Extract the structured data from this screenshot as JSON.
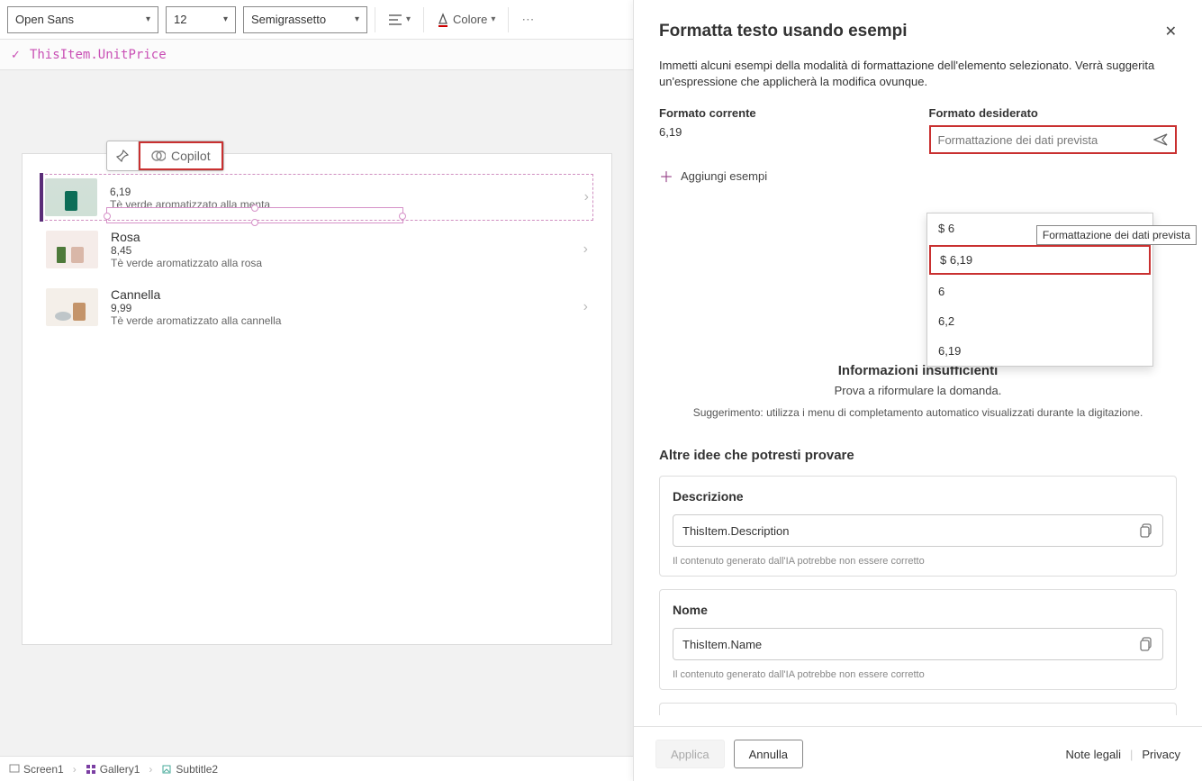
{
  "toolbar": {
    "font": "Open Sans",
    "size": "12",
    "weight": "Semigrassetto",
    "color_label": "Colore"
  },
  "formula": "ThisItem.UnitPrice",
  "gallery": {
    "copilot_label": "Copilot",
    "items": [
      {
        "title": "",
        "price": "6,19",
        "desc": "Tè verde aromatizzato alla menta"
      },
      {
        "title": "Rosa",
        "price": "8,45",
        "desc": "Tè verde aromatizzato alla rosa"
      },
      {
        "title": "Cannella",
        "price": "9,99",
        "desc": "Tè verde aromatizzato alla cannella"
      }
    ]
  },
  "breadcrumb": {
    "a": "Screen1",
    "b": "Gallery1",
    "c": "Subtitle2"
  },
  "panel": {
    "title": "Formatta testo usando esempi",
    "intro": "Immetti alcuni esempi della modalità di formattazione dell'elemento selezionato. Verrà suggerita un'espressione che applicherà la modifica ovunque.",
    "current_label": "Formato corrente",
    "current_value": "6,19",
    "desired_label": "Formato desiderato",
    "desired_placeholder": "Formattazione dei dati prevista",
    "add_examples": "Aggiungi esempi",
    "tooltip": "Formattazione dei dati prevista",
    "suggestions": [
      "$ 6",
      "$ 6,19",
      "6",
      "6,2",
      "6,19"
    ],
    "insufficient": "Informazioni insufficienti",
    "retry": "Prova a riformulare la domanda.",
    "hint": "Suggerimento: utilizza i menu di completamento automatico visualizzati durante la digitazione.",
    "ideas_title": "Altre idee che potresti provare",
    "ideas": [
      {
        "title": "Descrizione",
        "value": "ThisItem.Description"
      },
      {
        "title": "Nome",
        "value": "ThisItem.Name"
      }
    ],
    "ai_note": "Il contenuto generato dall'IA potrebbe non essere corretto",
    "apply": "Applica",
    "cancel": "Annulla",
    "legal": "Note legali",
    "privacy": "Privacy"
  }
}
